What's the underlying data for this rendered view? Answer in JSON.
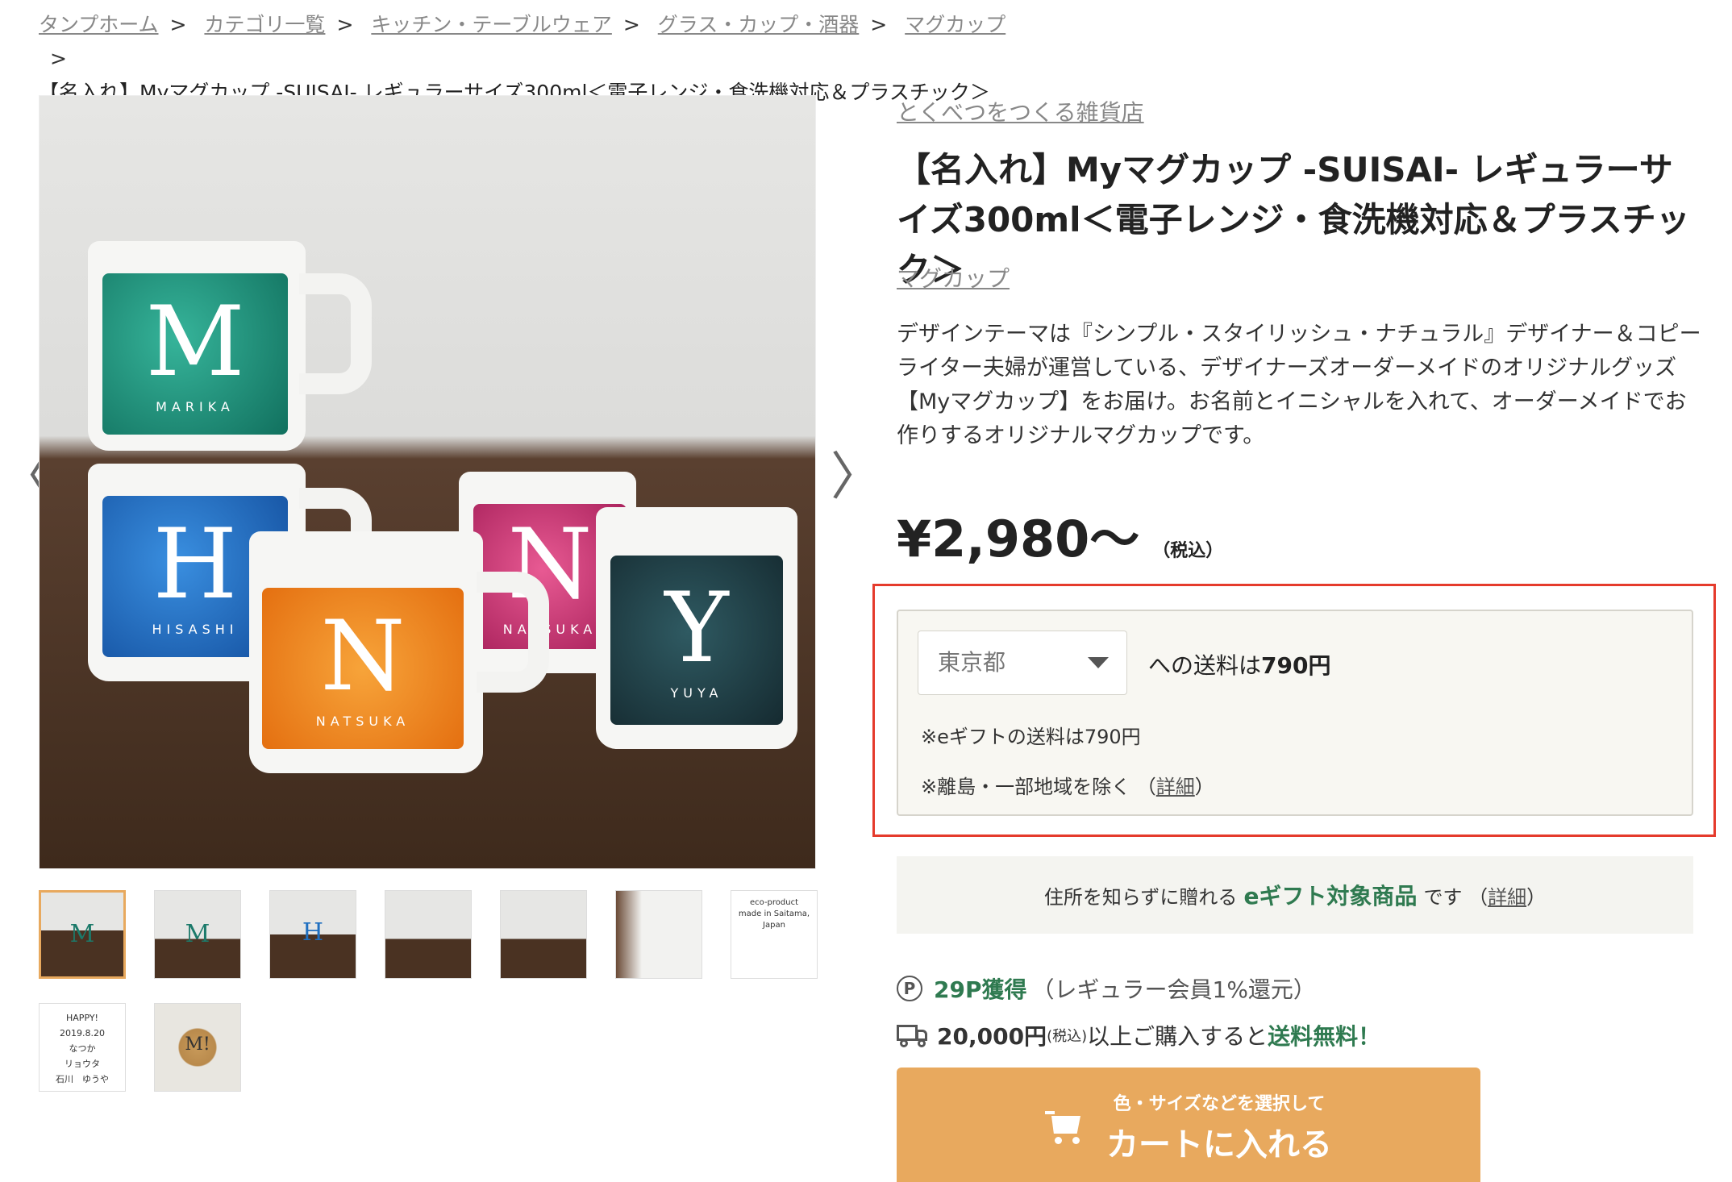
{
  "breadcrumb": {
    "items": [
      "タンプホーム",
      "カテゴリ一覧",
      "キッチン・テーブルウェア",
      "グラス・カップ・酒器",
      "マグカップ"
    ],
    "separator": ">",
    "current": "【名入れ】Myマグカップ -SUISAI- レギュラーサイズ300ml＜電子レンジ・食洗機対応＆プラスチック＞"
  },
  "gallery": {
    "prev_icon": "〈",
    "next_icon": "〉",
    "mugs": [
      {
        "letter": "M",
        "name": "MARIKA",
        "color": "#1f8f7a"
      },
      {
        "letter": "H",
        "name": "HISASHI",
        "color": "#1f6fc0"
      },
      {
        "letter": "N",
        "name": "NATSUKA",
        "color": "#f08a1c"
      },
      {
        "letter": "N",
        "name": "NATSUKA",
        "color": "#d23f7a"
      },
      {
        "letter": "Y",
        "name": "YUYA",
        "color": "#1c3a40"
      }
    ],
    "thumb_letters": [
      "M",
      "M",
      "H",
      "",
      "",
      ""
    ],
    "thumb_note_top": "eco-product",
    "thumb_note_sub": "made in Saitama, Japan",
    "card_lines": [
      "HAPPY!",
      "2019.8.20",
      "なつか",
      "リョウタ",
      "石川　ゆうや"
    ],
    "box_letter": "M!"
  },
  "product": {
    "shop_name": "とくべつをつくる雑貨店",
    "title": "【名入れ】Myマグカップ -SUISAI- レギュラーサイズ300ml＜電子レンジ・食洗機対応＆プラスチック＞",
    "category": "マグカップ",
    "description": "デザインテーマは『シンプル・スタイリッシュ・ナチュラル』デザイナー＆コピーライター夫婦が運営している、デザイナーズオーダーメイドのオリジナルグッズ【Myマグカップ】をお届け。お名前とイニシャルを入れて、オーダーメイドでお作りするオリジナルマグカップです。",
    "price": "¥2,980〜",
    "tax_label": "（税込）"
  },
  "shipping": {
    "prefecture": "東京都",
    "text_prefix": "への送料は",
    "amount": "790円",
    "egift_note": "※eギフトの送料は790円",
    "exclude_note": "※離島・一部地域を除く （",
    "detail_link": "詳細",
    "exclude_close": "）"
  },
  "egift": {
    "prefix": "住所を知らずに贈れる",
    "emphasis": "eギフト対象商品",
    "suffix": "です （",
    "detail_link": "詳細",
    "close": "）"
  },
  "points": {
    "icon": "P",
    "value": "29P獲得",
    "note": "（レギュラー会員1%還元）"
  },
  "free_shipping": {
    "amount": "20,000円",
    "tax": "(税込)",
    "middle": "以上ご購入すると",
    "emphasis": "送料無料！"
  },
  "cart": {
    "sub_label": "色・サイズなどを選択して",
    "main_label": "カートに入れる"
  },
  "colors": {
    "accent": "#e8a95e",
    "green": "#2f7a50",
    "highlight": "#e53b2c"
  }
}
